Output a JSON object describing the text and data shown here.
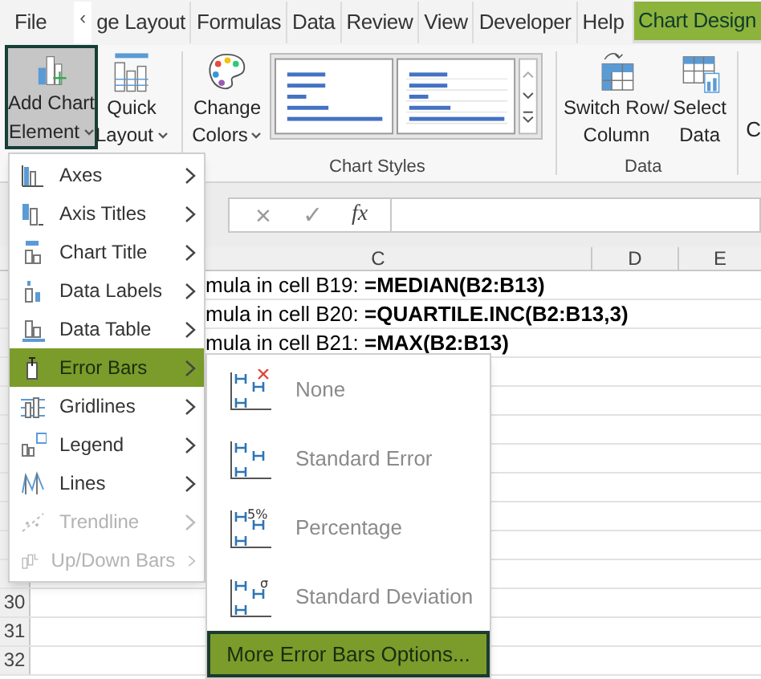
{
  "tabs": [
    {
      "label": "File",
      "selected": false
    },
    {
      "label": "‹",
      "kind": "scroll"
    },
    {
      "label": "ge Layout",
      "selected": false
    },
    {
      "label": "Formulas",
      "selected": false
    },
    {
      "label": "Data",
      "selected": false
    },
    {
      "label": "Review",
      "selected": false
    },
    {
      "label": "View",
      "selected": false
    },
    {
      "label": "Developer",
      "selected": false
    },
    {
      "label": "Help",
      "selected": false
    },
    {
      "label": "Chart Design",
      "selected": true
    }
  ],
  "ribbon": {
    "add_chart_element": {
      "line1": "Add Chart",
      "line2": "Element",
      "selected": true
    },
    "quick_layout": {
      "line1": "Quick",
      "line2": "Layout"
    },
    "change_colors": {
      "line1": "Change",
      "line2": "Colors"
    },
    "chart_styles_label": "Chart Styles",
    "switch_row_column": {
      "line1": "Switch Row/",
      "line2": "Column"
    },
    "select_data": {
      "line1": "Select",
      "line2": "Data"
    },
    "data_label": "Data",
    "cut_button": "C"
  },
  "formula_bar": {
    "cancel": "×",
    "enter": "✓",
    "function": "fx"
  },
  "columns": [
    "C",
    "D",
    "E"
  ],
  "cells": [
    "mula in cell B19: **=MEDIAN(B2:B13)**",
    "mula in cell B20: **=QUARTILE.INC(B2:B13,3)**",
    "mula in cell B21: **=MAX(B2:B13)**"
  ],
  "row_numbers": [
    "30",
    "31",
    "32"
  ],
  "menu": [
    {
      "label": "Axes",
      "selected": false,
      "disabled": false
    },
    {
      "label": "Axis Titles",
      "selected": false,
      "disabled": false
    },
    {
      "label": "Chart Title",
      "selected": false,
      "disabled": false
    },
    {
      "label": "Data Labels",
      "selected": false,
      "disabled": false
    },
    {
      "label": "Data Table",
      "selected": false,
      "disabled": false
    },
    {
      "label": "Error Bars",
      "selected": true,
      "disabled": false
    },
    {
      "label": "Gridlines",
      "selected": false,
      "disabled": false
    },
    {
      "label": "Legend",
      "selected": false,
      "disabled": false
    },
    {
      "label": "Lines",
      "selected": false,
      "disabled": false
    },
    {
      "label": "Trendline",
      "selected": false,
      "disabled": true
    },
    {
      "label": "Up/Down Bars",
      "selected": false,
      "disabled": true
    }
  ],
  "submenu": {
    "items": [
      {
        "label": "None",
        "kind": "none"
      },
      {
        "label": "Standard Error",
        "kind": "plain"
      },
      {
        "label": "Percentage",
        "kind": "text",
        "mark": "5%"
      },
      {
        "label": "Standard Deviation",
        "kind": "text",
        "mark": "σ"
      }
    ],
    "more_button": "More Error Bars Options..."
  }
}
